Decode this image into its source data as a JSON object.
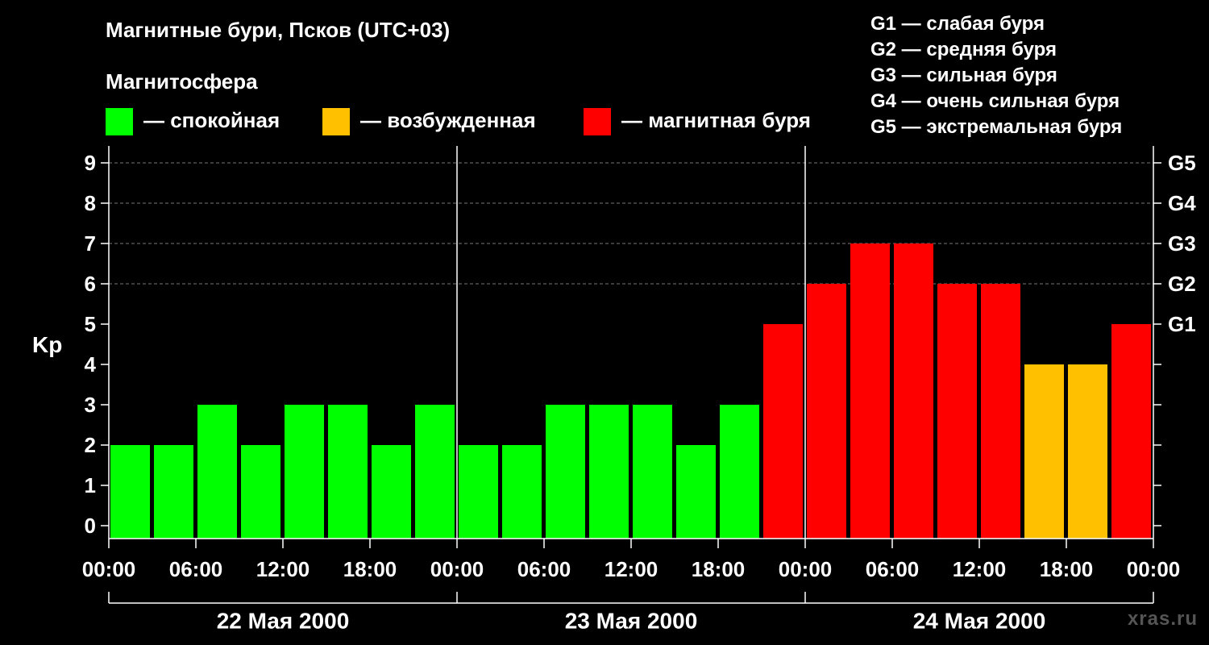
{
  "header": {
    "title": "Магнитные бури, Псков (UTC+03)",
    "subtitle": "Магнитосфера"
  },
  "legend": {
    "items": [
      {
        "label": "— спокойная",
        "color": "#00ff00"
      },
      {
        "label": "— возбужденная",
        "color": "#ffc000"
      },
      {
        "label": "— магнитная буря",
        "color": "#ff0000"
      }
    ],
    "g_scale": [
      "G1 — слабая буря",
      "G2 — средняя буря",
      "G3 — сильная буря",
      "G4 — очень сильная буря",
      "G5 — экстремальная буря"
    ]
  },
  "watermark": "xras.ru",
  "chart_data": {
    "type": "bar",
    "ylabel": "Kp",
    "ylim": [
      0,
      9
    ],
    "y_ticks": [
      0,
      1,
      2,
      3,
      4,
      5,
      6,
      7,
      8,
      9
    ],
    "right_ticks": [
      {
        "value": 5,
        "label": "G1"
      },
      {
        "value": 6,
        "label": "G2"
      },
      {
        "value": 7,
        "label": "G3"
      },
      {
        "value": 8,
        "label": "G4"
      },
      {
        "value": 9,
        "label": "G5"
      }
    ],
    "grid_lines": [
      6,
      7,
      8,
      9
    ],
    "x_tick_labels": [
      "00:00",
      "06:00",
      "12:00",
      "18:00",
      "00:00",
      "06:00",
      "12:00",
      "18:00",
      "00:00",
      "06:00",
      "12:00",
      "18:00",
      "00:00"
    ],
    "days": [
      "22 Мая 2000",
      "23 Мая 2000",
      "24 Мая 2000"
    ],
    "interval_hours": 3,
    "values": [
      2,
      2,
      3,
      2,
      3,
      3,
      2,
      3,
      2,
      2,
      3,
      3,
      3,
      2,
      3,
      5,
      6,
      7,
      7,
      6,
      6,
      4,
      4,
      5
    ],
    "colors": {
      "quiet": "#00ff00",
      "active": "#ffc000",
      "storm": "#ff0000"
    },
    "thresholds": {
      "active": 4,
      "storm": 5
    }
  }
}
